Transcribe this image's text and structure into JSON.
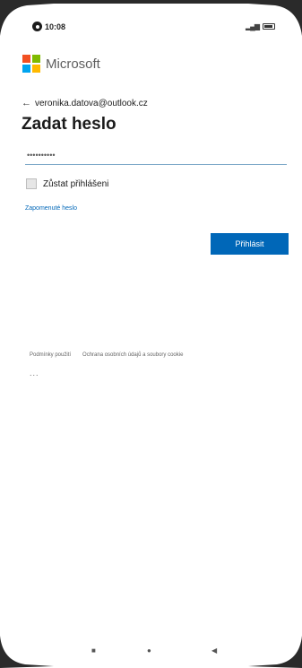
{
  "status": {
    "time": "10:08",
    "icon_signal": "signal-icon",
    "icon_battery": "battery-icon"
  },
  "brand": {
    "name": "Microsoft",
    "logo_colors": [
      "#f25022",
      "#7fba00",
      "#00a4ef",
      "#ffb900"
    ]
  },
  "account": {
    "email": "veronika.datova@outlook.cz",
    "back_icon": "←"
  },
  "page": {
    "title": "Zadat heslo"
  },
  "password": {
    "value": "••••••••••"
  },
  "remember": {
    "label": "Zůstat přihlášeni",
    "checked": false
  },
  "forgot": {
    "label": "Zapomenuté heslo"
  },
  "signin": {
    "label": "Přihlásit",
    "color": "#0067b8"
  },
  "footer": {
    "terms": "Podmínky použití",
    "privacy": "Ochrana osobních údajů a soubory cookie",
    "more": "..."
  },
  "nav": {
    "recents": "■",
    "home": "●",
    "back": "◀"
  }
}
